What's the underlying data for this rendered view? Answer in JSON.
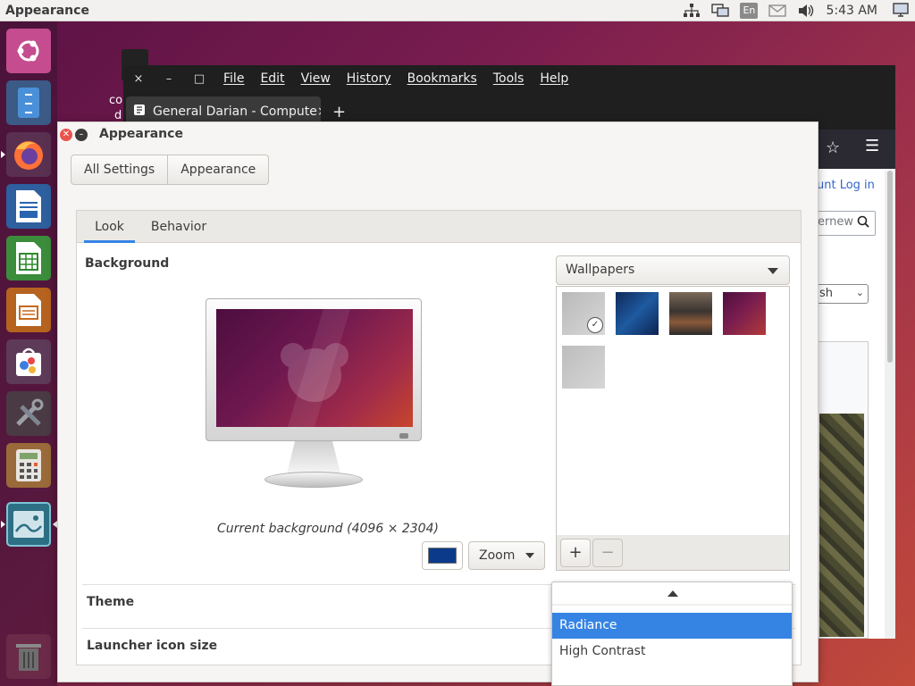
{
  "top_panel": {
    "app_title": "Appearance",
    "keyboard_layout": "En",
    "clock": "5:43 AM",
    "icons": [
      "network-icon",
      "display-icon",
      "keyboard-layout-icon",
      "mail-icon",
      "volume-icon",
      "computer-icon"
    ]
  },
  "launcher": {
    "items": [
      "ubuntu-dash-icon",
      "files-icon",
      "firefox-icon",
      "writer-icon",
      "calc-icon",
      "impress-icon",
      "software-center-icon",
      "settings-tools-icon",
      "calculator-icon",
      "image-viewer-icon",
      "trash-icon"
    ]
  },
  "desktop": {
    "file_label_line1": "co",
    "file_label_line2": "d"
  },
  "browser": {
    "window_buttons": {
      "close": "×",
      "minimize": "–",
      "maximize": "□"
    },
    "menu": [
      "File",
      "Edit",
      "View",
      "History",
      "Bookmarks",
      "Tools",
      "Help"
    ],
    "tab_title": "General Darian - Compute",
    "tab_close": "×",
    "new_tab": "+",
    "page_links": "unt  Log in",
    "search_text": "ernew",
    "select_text": "sh"
  },
  "appearance": {
    "title": "Appearance",
    "breadcrumbs": [
      "All Settings",
      "Appearance"
    ],
    "tabs": [
      "Look",
      "Behavior"
    ],
    "active_tab": "Look",
    "background_label": "Background",
    "current_background": "Current background (4096 × 2304)",
    "primary_color": "#0b3a8a",
    "zoom_label": "Zoom",
    "wallpaper_source": "Wallpapers",
    "add_button": "+",
    "remove_button": "−",
    "theme_label": "Theme",
    "launcher_icon_size_label": "Launcher icon size"
  },
  "theme_dropdown": {
    "options": [
      "Radiance",
      "High Contrast"
    ],
    "selected": "Radiance"
  },
  "colors": {
    "accent": "#3584e4",
    "close_button": "#e9544d"
  }
}
